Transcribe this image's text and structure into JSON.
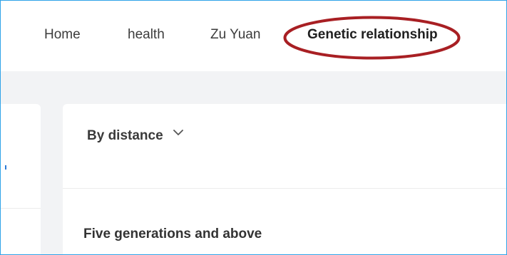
{
  "nav": {
    "items": [
      {
        "label": "Home"
      },
      {
        "label": "health"
      },
      {
        "label": "Zu Yuan"
      },
      {
        "label": "Genetic relationship",
        "active": true
      }
    ]
  },
  "filter": {
    "sort_label": "By distance"
  },
  "section": {
    "title": "Five generations and above"
  },
  "colors": {
    "highlight_oval": "#a81f23",
    "frame_border": "#2fa3e8",
    "content_bg": "#f2f3f5"
  }
}
